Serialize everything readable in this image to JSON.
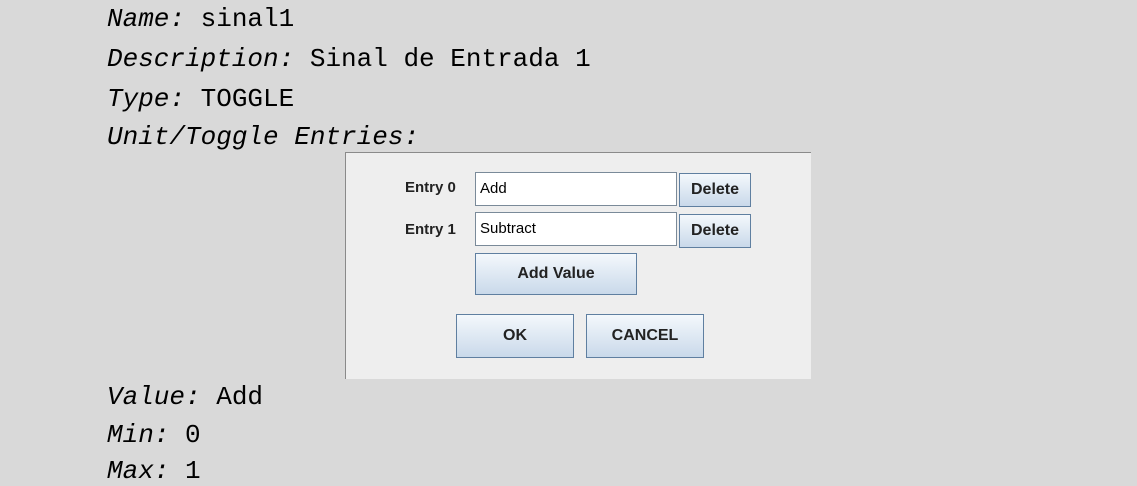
{
  "properties": {
    "name_label": "Name:",
    "name_value": " sinal1",
    "description_label": "Description:",
    "description_value": " Sinal de Entrada 1",
    "type_label": "Type:",
    "type_value": " TOGGLE",
    "unit_label": "Unit/Toggle Entries:",
    "value_label": "Value:",
    "value_value": " Add",
    "min_label": "Min:",
    "min_value": " 0",
    "max_label": "Max:",
    "max_value": " 1"
  },
  "dialog": {
    "entries": [
      {
        "label": "Entry 0",
        "value": "Add",
        "delete_label": "Delete"
      },
      {
        "label": "Entry 1",
        "value": "Subtract",
        "delete_label": "Delete"
      }
    ],
    "add_value_label": "Add Value",
    "ok_label": "OK",
    "cancel_label": "CANCEL"
  }
}
